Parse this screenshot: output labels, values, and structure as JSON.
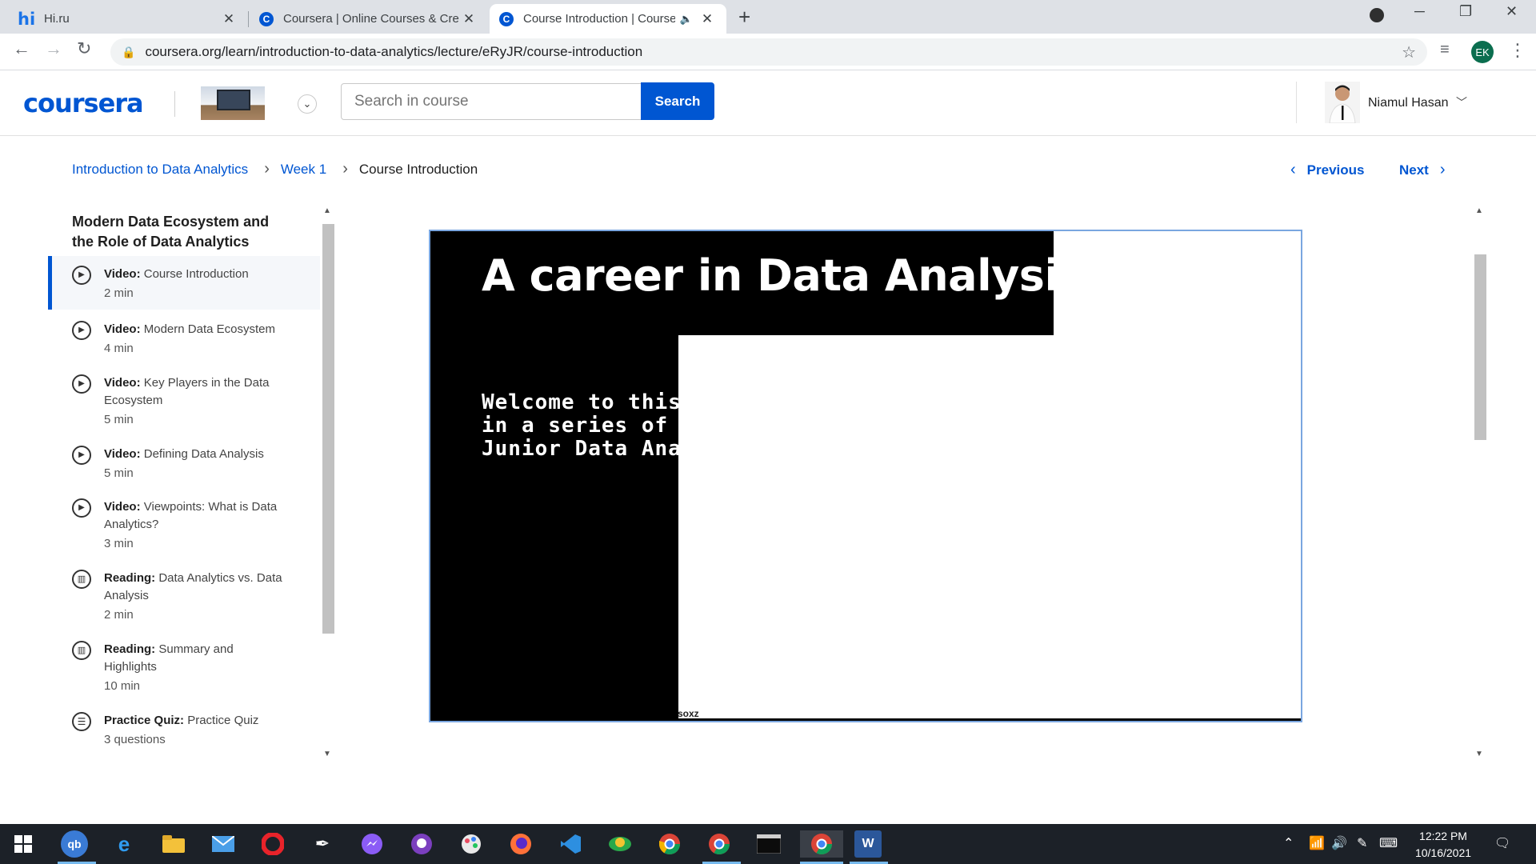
{
  "browser": {
    "tabs": [
      {
        "title": "Hi.ru",
        "favicon": "hi-favicon"
      },
      {
        "title": "Coursera | Online Courses & Cre",
        "favicon": "coursera-favicon"
      },
      {
        "title": "Course Introduction | Course",
        "favicon": "coursera-favicon"
      }
    ],
    "url": "coursera.org/learn/introduction-to-data-analytics/lecture/eRyJR/course-introduction",
    "profile_initials": "EK"
  },
  "header": {
    "logo": "coursera",
    "search_placeholder": "Search in course",
    "search_button": "Search",
    "user_name": "Niamul Hasan"
  },
  "breadcrumb": {
    "course": "Introduction to Data Analytics",
    "week": "Week 1",
    "current": "Course Introduction"
  },
  "nav": {
    "previous": "Previous",
    "next": "Next"
  },
  "sidebar": {
    "module_title": "Modern Data Ecosystem and the Role of Data Analytics",
    "items": [
      {
        "kind": "Video:",
        "title": "Course Introduction",
        "meta": "2 min",
        "icon": "play-icon"
      },
      {
        "kind": "Video:",
        "title": "Modern Data Ecosystem",
        "meta": "4 min",
        "icon": "play-icon"
      },
      {
        "kind": "Video:",
        "title": "Key Players in the Data Ecosystem",
        "meta": "5 min",
        "icon": "play-icon"
      },
      {
        "kind": "Video:",
        "title": "Defining Data Analysis",
        "meta": "5 min",
        "icon": "play-icon"
      },
      {
        "kind": "Video:",
        "title": "Viewpoints: What is Data Analytics?",
        "meta": "3 min",
        "icon": "play-icon"
      },
      {
        "kind": "Reading:",
        "title": "Data Analytics vs. Data Analysis",
        "meta": "2 min",
        "icon": "book-icon"
      },
      {
        "kind": "Reading:",
        "title": "Summary and Highlights",
        "meta": "10 min",
        "icon": "book-icon"
      },
      {
        "kind": "Practice Quiz:",
        "title": "Practice Quiz",
        "meta": "3 questions",
        "icon": "quiz-icon"
      }
    ]
  },
  "video": {
    "title": "A career in Data Analysis",
    "body": "Welcome to this\nin a series of cou\nJunior Data Anal",
    "watermark": "soxz"
  },
  "taskbar": {
    "time": "12:22 PM",
    "date": "10/16/2021",
    "word_label": "W",
    "chrome_profile": "EK"
  },
  "colors": {
    "accent": "#0056d2",
    "taskbar": "#1c2128"
  }
}
